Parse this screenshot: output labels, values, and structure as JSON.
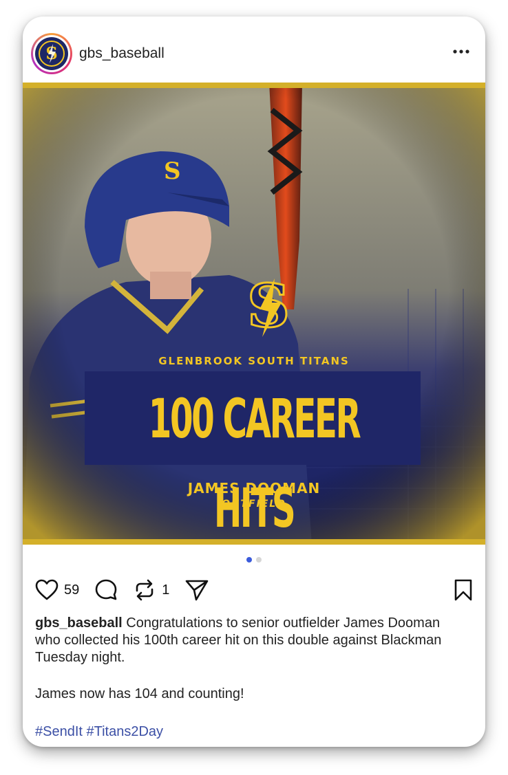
{
  "post": {
    "username": "gbs_baseball",
    "image": {
      "school_name": "GLENBROOK SOUTH TITANS",
      "headline": "100 CAREER HITS",
      "player_name": "JAMES DOOMAN",
      "player_position": "OUTFIELD",
      "colors": {
        "navy": "#1f2667",
        "gold": "#f3c623"
      }
    },
    "carousel": {
      "total": 2,
      "active": 1
    },
    "likes": "59",
    "reposts": "1",
    "caption": {
      "username": "gbs_baseball",
      "text": "Congratulations to senior outfielder James Dooman who collected his 100th career hit on this double against Blackman Tuesday night.",
      "line2": "James now has 104 and counting!"
    },
    "hashtags": [
      "#SendIt",
      "#Titans2Day"
    ],
    "icons": {
      "like": "heart-icon",
      "comment": "comment-icon",
      "repost": "repost-icon",
      "share": "send-icon",
      "save": "bookmark-icon",
      "more": "more-icon"
    }
  }
}
